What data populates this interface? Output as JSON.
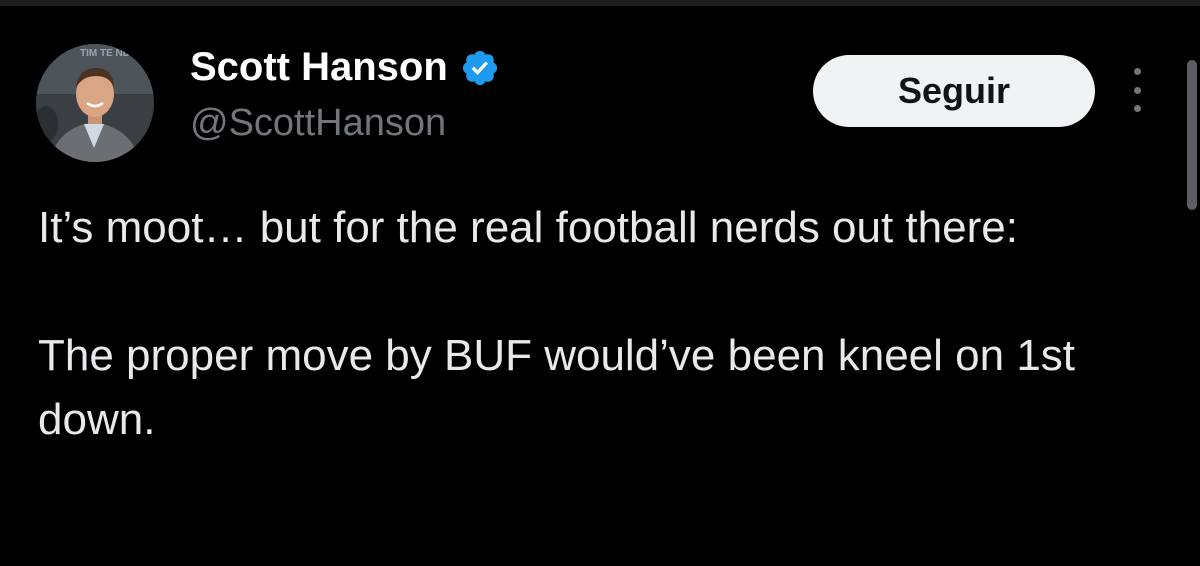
{
  "author": {
    "name": "Scott Hanson",
    "handle": "@ScottHanson",
    "verified": true,
    "avatar_backdrop_text": "TIM TE NDAN"
  },
  "actions": {
    "follow_label": "Seguir"
  },
  "tweet": {
    "paragraphs": [
      "It’s moot… but for the real football nerds out there:",
      "The proper move by BUF would’ve been kneel on 1st down."
    ]
  },
  "icons": {
    "verified": "verified-badge-icon",
    "more": "more-options-icon"
  },
  "colors": {
    "background": "#000000",
    "text": "#e7e9ea",
    "muted": "#71767b",
    "verified_blue": "#1d9bf0",
    "button_bg": "#eff3f4"
  }
}
